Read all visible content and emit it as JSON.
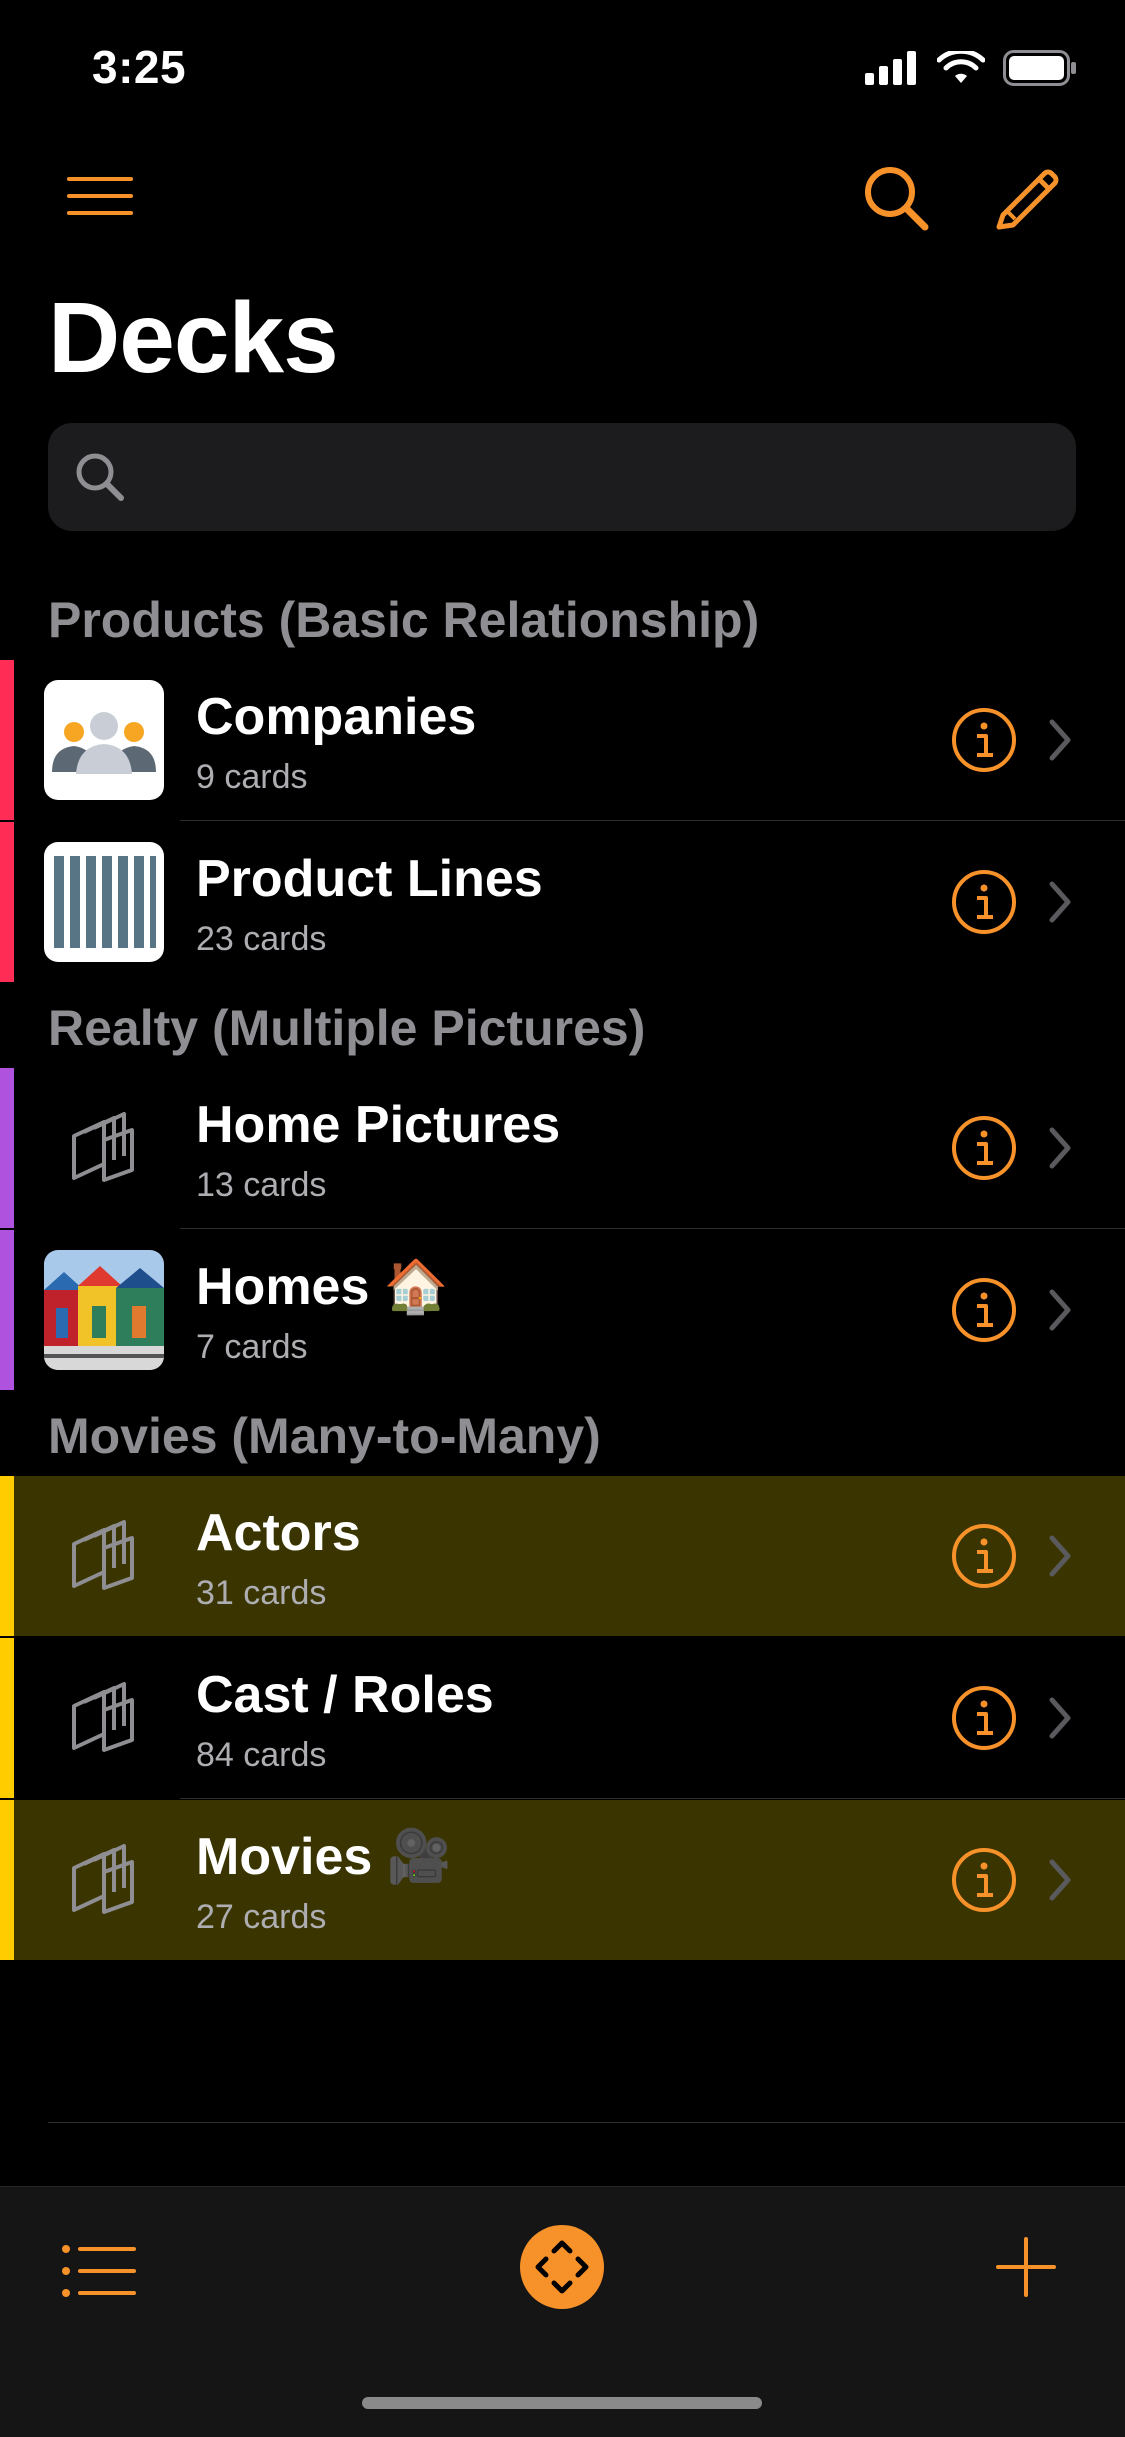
{
  "status_bar": {
    "time": "3:25"
  },
  "header": {
    "title": "Decks"
  },
  "search": {
    "placeholder": ""
  },
  "colors": {
    "accent": "#f7922a",
    "pink": "#ff2d55",
    "purple": "#af52de",
    "yellow": "#ffcc00",
    "highlight": "#3a3500"
  },
  "sections": [
    {
      "title": "Products (Basic Relationship)",
      "rows": [
        {
          "name": "Companies",
          "count": "9 cards",
          "icon": "people-icon"
        },
        {
          "name": "Product Lines",
          "count": "23 cards",
          "icon": "barcode-icon"
        }
      ]
    },
    {
      "title": "Realty (Multiple Pictures)",
      "rows": [
        {
          "name": "Home Pictures",
          "count": "13 cards",
          "icon": "cards-stack-icon"
        },
        {
          "name": "Homes 🏠",
          "count": "7 cards",
          "icon": "house-photo"
        }
      ]
    },
    {
      "title": "Movies (Many-to-Many)",
      "rows": [
        {
          "name": "Actors",
          "count": "31 cards",
          "icon": "cards-stack-icon",
          "highlighted": true
        },
        {
          "name": "Cast / Roles",
          "count": "84 cards",
          "icon": "cards-stack-icon"
        },
        {
          "name": "Movies 🎥",
          "count": "27 cards",
          "icon": "cards-stack-icon",
          "highlighted": true
        }
      ]
    }
  ]
}
